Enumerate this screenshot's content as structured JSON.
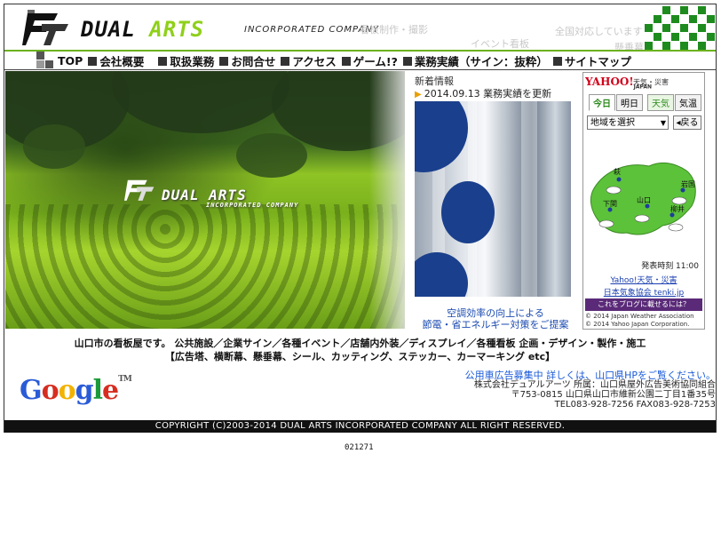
{
  "header": {
    "logo_main_a": "DUAL ",
    "logo_main_b": "ARTS",
    "logo_sub": "INCORPORATED COMPANY",
    "ghost_1": "看板制作・撮影",
    "ghost_2": "イベント看板",
    "ghost_3": "全国対応しています",
    "ghost_4": "懸垂幕"
  },
  "nav": {
    "items": [
      {
        "label": "TOP"
      },
      {
        "label": "会社概要"
      },
      {
        "label": "取扱業務"
      },
      {
        "label": "お問合せ"
      },
      {
        "label": "アクセス"
      },
      {
        "label": "ゲーム!?"
      },
      {
        "label": "業務実績（サイン：抜粋）"
      },
      {
        "label": "サイトマップ"
      }
    ]
  },
  "hero": {
    "logo_text": "DUAL ARTS",
    "logo_sub": "INCORPORATED COMPANY"
  },
  "news": {
    "title": "新着情報",
    "link": "2014.09.13 業務実績を更新",
    "caption_1": "空調効率の向上による",
    "caption_2": "節電・省エネルギー対策をご提案"
  },
  "weather": {
    "logo": "YAHOO!",
    "logo_sub": "JAPAN",
    "heading": "天気・災害",
    "tabs": [
      "今日",
      "明日",
      "天気",
      "気温"
    ],
    "select_value": "地域を選択",
    "back_label": "◂戻る",
    "cities": [
      "萩",
      "山口",
      "下関",
      "岩国",
      "柳井"
    ],
    "time": "発表時刻 11:00",
    "link_1": "Yahoo!天気・災害",
    "link_2": "日本気象協会 tenki.jp",
    "blog_button": "これをブログに載せるには？",
    "copy_1": "© 2014 Japan Weather Association",
    "copy_2": "© 2014 Yahoo Japan Corporation."
  },
  "tagline": {
    "line_1": "山口市の看板屋です。 公共施設／企業サイン／各種イベント／店舗内外装／ディスプレイ／各種看板 企画・デザイン・製作・施工",
    "line_2": "【広告塔、横断幕、懸垂幕、シール、カッティング、ステッカー、カーマーキング etc】"
  },
  "google": {
    "text": "Google",
    "tm": "TM"
  },
  "address": {
    "notice": "公用車広告募集中 詳しくは、山口県HPをご覧ください。",
    "company": "株式会社デュアルアーツ 所属：山口県屋外広告美術協同組合",
    "postal": "〒753-0815 山口県山口市維新公園二丁目1番35号",
    "tel": "TEL083-928-7256 FAX083-928-7253"
  },
  "footer": {
    "copyright": "COPYRIGHT (C)2003-2014 DUAL ARTS INCORPORATED COMPANY ALL RIGHT RESERVED.",
    "counter": "021271"
  },
  "colors": {
    "accent_green": "#8fd01a",
    "deco_green": "#1e8b1e",
    "link_blue": "#1a4ab0",
    "yahoo_red": "#d0021b"
  }
}
